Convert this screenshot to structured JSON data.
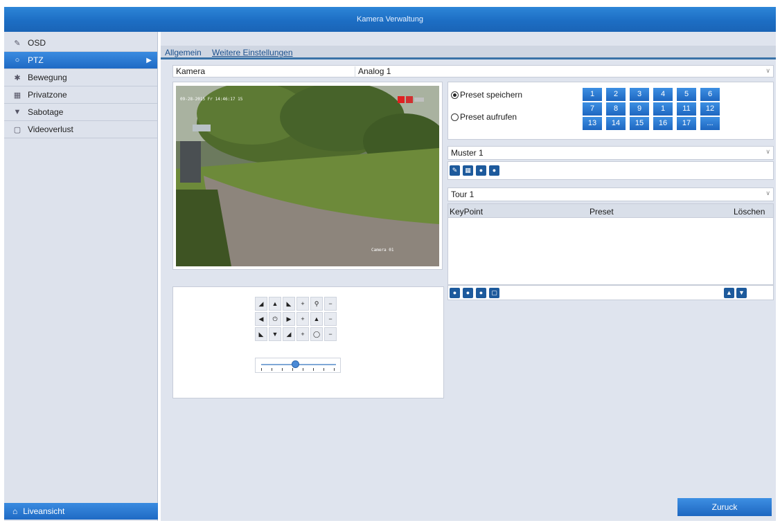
{
  "window": {
    "title": "Kamera Verwaltung"
  },
  "sidebar": {
    "items": [
      {
        "label": "OSD",
        "icon": "osd-icon",
        "active": false
      },
      {
        "label": "PTZ",
        "icon": "ptz-icon",
        "active": true
      },
      {
        "label": "Bewegung",
        "icon": "motion-icon",
        "active": false
      },
      {
        "label": "Privatzone",
        "icon": "privacy-icon",
        "active": false
      },
      {
        "label": "Sabotage",
        "icon": "tamper-icon",
        "active": false
      },
      {
        "label": "Videoverlust",
        "icon": "video-loss-icon",
        "active": false
      }
    ],
    "bottom_button": "Liveansicht"
  },
  "tabs": [
    {
      "label": "Allgemein"
    },
    {
      "label": "Weitere Einstellungen"
    }
  ],
  "camera": {
    "label": "Kamera",
    "value": "Analog 1"
  },
  "video": {
    "timestamp": "09-28-2015 Fr 14:46:17 15",
    "camera_name": "Camera 01"
  },
  "preset": {
    "save_label": "Preset speichern",
    "call_label": "Preset aufrufen",
    "selected": "save",
    "buttons": [
      "1",
      "2",
      "3",
      "4",
      "5",
      "6",
      "7",
      "8",
      "9",
      "1",
      "11",
      "12",
      "13",
      "14",
      "15",
      "16",
      "17",
      "..."
    ]
  },
  "pattern": {
    "value": "Muster 1"
  },
  "tour": {
    "value": "Tour 1",
    "columns": [
      "KeyPoint",
      "Preset",
      "Löschen"
    ]
  },
  "actions": {
    "back_label": "Zuruck"
  },
  "colors": {
    "accent": "#1e67c0",
    "panel_bg": "#dfe4ee",
    "sidebar_bg": "#dde2ec"
  }
}
